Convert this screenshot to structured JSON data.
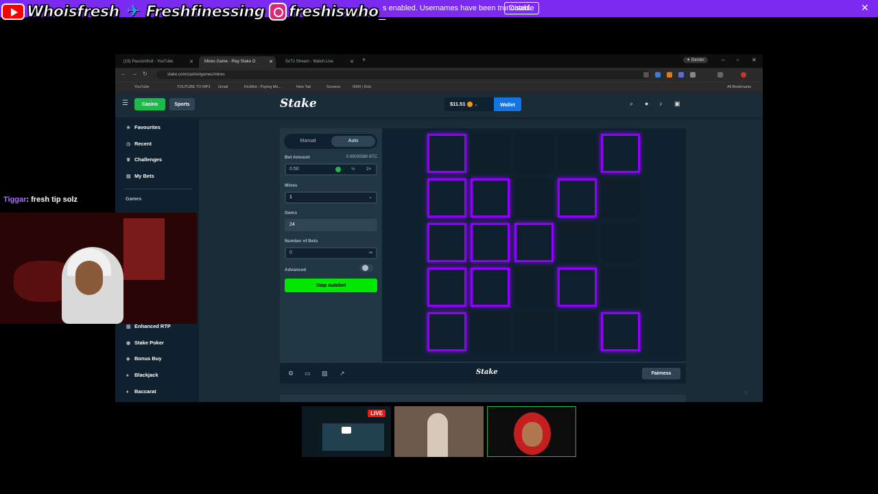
{
  "stream": {
    "banner_message": "s enabled. Usernames have been truncated.",
    "banner_disable": "Disable",
    "banner_close": "✕",
    "socials": [
      {
        "icon": "youtube-icon",
        "handle": "Whoisfresh"
      },
      {
        "icon": "twitter-icon",
        "handle": "Freshfinessing"
      },
      {
        "icon": "instagram-icon",
        "handle": "freshiswho_"
      }
    ],
    "chat": {
      "user": "Tiggar",
      "message": ": fresh tip solz"
    },
    "thumb_live": "LIVE"
  },
  "browser": {
    "tabs": [
      {
        "label": "(15) Passionfruit - YouTube"
      },
      {
        "label": "Mines Game - Play Stake O"
      },
      {
        "label": "SoTz Stream - Watch Live"
      }
    ],
    "new_tab": "+",
    "gemini": "✦ Gemini",
    "url": "stake.com/casino/games/mines",
    "bookmarks": [
      "YouTube",
      "YOUTUBE TO MP3",
      "Gmail",
      "KickBot - Paying Me...",
      "New Tab",
      "Screens",
      "IIIIIIII | Kick"
    ],
    "all_bookmarks": "All Bookmarks"
  },
  "header": {
    "casino": "Casino",
    "sports": "Sports",
    "logo": "Stake",
    "balance": "$11.51",
    "wallet": "Wallet"
  },
  "sidebar": {
    "items": [
      {
        "label": "Favourites",
        "icon": "star-icon"
      },
      {
        "label": "Recent",
        "icon": "clock-icon"
      },
      {
        "label": "Challenges",
        "icon": "trophy-icon"
      },
      {
        "label": "My Bets",
        "icon": "ticket-icon"
      }
    ],
    "section": "Games",
    "items_lower": [
      {
        "label": "Enhanced RTP",
        "icon": "rtp-icon"
      },
      {
        "label": "Stake Poker",
        "icon": "poker-chip-icon"
      },
      {
        "label": "Bonus Buy",
        "icon": "bonus-icon"
      },
      {
        "label": "Blackjack",
        "icon": "cards-icon"
      },
      {
        "label": "Baccarat",
        "icon": "baccarat-icon"
      }
    ]
  },
  "controls": {
    "tab_manual": "Manual",
    "tab_auto": "Auto",
    "selected_tab": "Auto",
    "bet_amount_label": "Bet Amount",
    "bet_amount_btc": "0.00000580 BTC",
    "bet_amount_value": "0.50",
    "half": "½",
    "double": "2×",
    "mines_label": "Mines",
    "mines_value": "1",
    "gems_label": "Gems",
    "gems_value": "24",
    "num_bets_label": "Number of Bets",
    "num_bets_value": "0",
    "advanced_label": "Advanced",
    "stop_button": "Stop Autobet"
  },
  "board": {
    "rows": 5,
    "cols": 5,
    "selected": [
      [
        true,
        false,
        false,
        false,
        true
      ],
      [
        true,
        true,
        false,
        true,
        false
      ],
      [
        true,
        true,
        true,
        false,
        false
      ],
      [
        true,
        true,
        false,
        true,
        false
      ],
      [
        true,
        false,
        false,
        false,
        true
      ]
    ],
    "accent_color": "#9000ff"
  },
  "footer": {
    "logo": "Stake",
    "fairness": "Fairness"
  }
}
